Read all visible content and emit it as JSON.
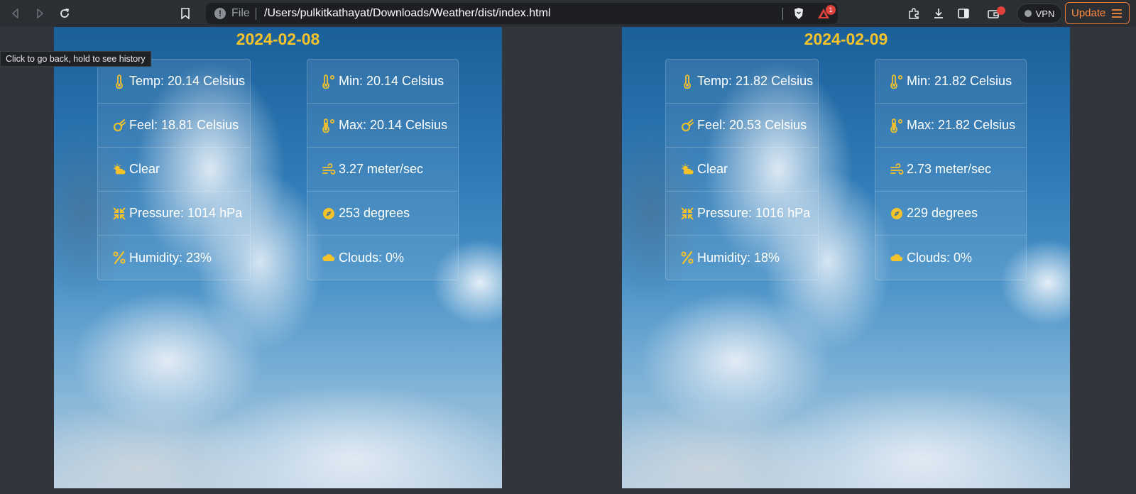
{
  "browser": {
    "url_scheme_label": "File",
    "url": "/Users/pulkitkathayat/Downloads/Weather/dist/index.html",
    "rewards_badge_count": "1",
    "vpn_label": "VPN",
    "update_label": "Update",
    "tooltip": "Click to go back, hold to see history"
  },
  "days": [
    {
      "date": "2024-02-08",
      "left": [
        {
          "icon": "thermometer-icon",
          "text": "Temp: 20.14 Celsius"
        },
        {
          "icon": "meteor-icon",
          "text": "Feel: 18.81 Celsius"
        },
        {
          "icon": "sun-cloud-icon",
          "text": "Clear"
        },
        {
          "icon": "compress-icon",
          "text": "Pressure: 1014 hPa"
        },
        {
          "icon": "percent-icon",
          "text": "Humidity: 23%"
        }
      ],
      "right": [
        {
          "icon": "temperature-low-icon",
          "text": "Min: 20.14 Celsius"
        },
        {
          "icon": "temperature-high-icon",
          "text": "Max: 20.14 Celsius"
        },
        {
          "icon": "wind-icon",
          "text": "3.27 meter/sec"
        },
        {
          "icon": "compass-icon",
          "text": "253 degrees"
        },
        {
          "icon": "cloud-icon",
          "text": "Clouds: 0%"
        }
      ]
    },
    {
      "date": "2024-02-09",
      "left": [
        {
          "icon": "thermometer-icon",
          "text": "Temp: 21.82 Celsius"
        },
        {
          "icon": "meteor-icon",
          "text": "Feel: 20.53 Celsius"
        },
        {
          "icon": "sun-cloud-icon",
          "text": "Clear"
        },
        {
          "icon": "compress-icon",
          "text": "Pressure: 1016 hPa"
        },
        {
          "icon": "percent-icon",
          "text": "Humidity: 18%"
        }
      ],
      "right": [
        {
          "icon": "temperature-low-icon",
          "text": "Min: 21.82 Celsius"
        },
        {
          "icon": "temperature-high-icon",
          "text": "Max: 21.82 Celsius"
        },
        {
          "icon": "wind-icon",
          "text": "2.73 meter/sec"
        },
        {
          "icon": "compass-icon",
          "text": "229 degrees"
        },
        {
          "icon": "cloud-icon",
          "text": "Clouds: 0%"
        }
      ]
    }
  ],
  "colors": {
    "accent": "#f4c22b",
    "page_bg": "#32363c",
    "update_orange": "#ff8a3d"
  }
}
